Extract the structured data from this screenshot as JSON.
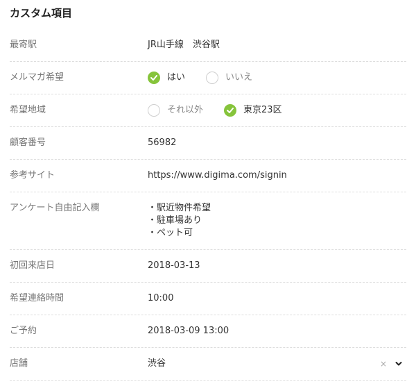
{
  "section_title": "カスタム項目",
  "fields": {
    "nearest_station": {
      "label": "最寄駅",
      "value": "JR山手線　渋谷駅"
    },
    "newsletter": {
      "label": "メルマガ希望",
      "options": [
        {
          "label": "はい",
          "selected": true
        },
        {
          "label": "いいえ",
          "selected": false
        }
      ]
    },
    "region": {
      "label": "希望地域",
      "options": [
        {
          "label": "それ以外",
          "selected": false
        },
        {
          "label": "東京23区",
          "selected": true
        }
      ]
    },
    "customer_number": {
      "label": "顧客番号",
      "value": "56982"
    },
    "reference_site": {
      "label": "参考サイト",
      "value": "https://www.digima.com/signin"
    },
    "survey": {
      "label": "アンケート自由記入欄",
      "lines": [
        "・駅近物件希望",
        "・駐車場あり",
        "・ペット可"
      ]
    },
    "first_visit": {
      "label": "初回来店日",
      "value": "2018-03-13"
    },
    "contact_time": {
      "label": "希望連絡時間",
      "value": "10:00"
    },
    "reservation": {
      "label": "ご予約",
      "value": "2018-03-09 13:00"
    },
    "store": {
      "label": "店舗",
      "value": "渋谷",
      "clear_glyph": "×"
    }
  },
  "colors": {
    "accent_green": "#86c43b",
    "label_gray": "#777777",
    "divider": "#dddddd"
  },
  "icons": {
    "check": "check-icon",
    "dropdown": "chevron-down-icon",
    "clear": "clear-icon"
  }
}
